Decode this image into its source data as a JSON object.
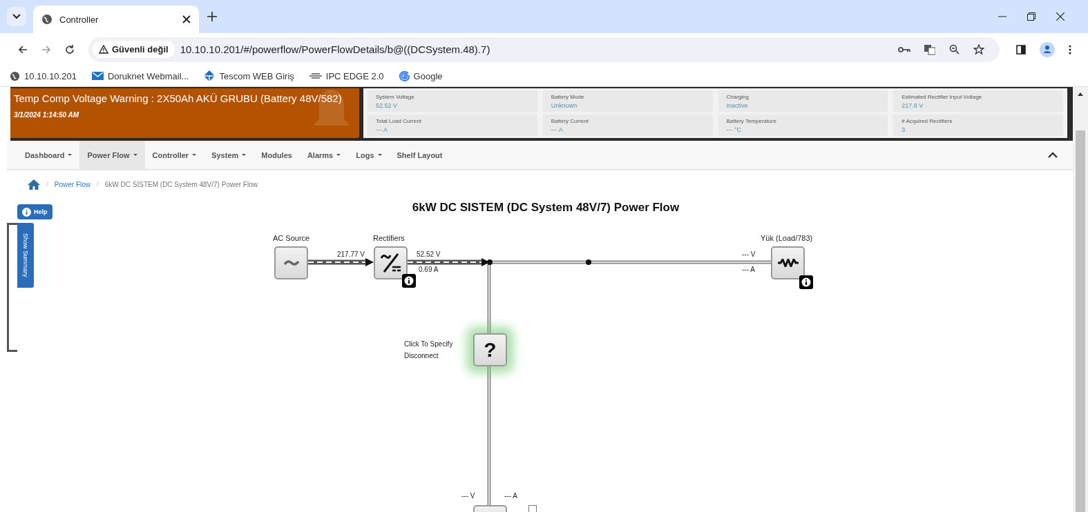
{
  "browser": {
    "tab": {
      "title": "Controller"
    },
    "address": {
      "security_label": "Güvenli değil",
      "url": "10.10.10.201/#/powerflow/PowerFlowDetails/b@((DCSystem.48).7)"
    },
    "bookmarks": [
      {
        "label": "10.10.10.201",
        "kind": "globe"
      },
      {
        "label": "Doruknet Webmail...",
        "kind": "mail"
      },
      {
        "label": "Tescom WEB Giriş",
        "kind": "diamond"
      },
      {
        "label": "IPC EDGE 2.0",
        "kind": "logo"
      },
      {
        "label": "Google",
        "kind": "google"
      }
    ]
  },
  "alarm": {
    "message": "Temp Comp Voltage Warning : 2X50Ah AKÜ GRUBU (Battery 48V/582)",
    "timestamp": "3/1/2024 1:14:50 AM"
  },
  "stats": [
    {
      "label": "System Voltage",
      "value": "52.52 V"
    },
    {
      "label": "Battery Mode",
      "value": "Unknown"
    },
    {
      "label": "Charging",
      "value": "Inactive"
    },
    {
      "label": "Estimated Rectifier Input Voltage",
      "value": "217.8 V"
    },
    {
      "label": "Total Load Current",
      "value": "--- A"
    },
    {
      "label": "Battery Current",
      "value": "--- A"
    },
    {
      "label": "Battery Temperature",
      "value": "--- °C"
    },
    {
      "label": "# Acquired Rectifiers",
      "value": "3"
    }
  ],
  "nav": [
    {
      "label": "Dashboard",
      "dropdown": true,
      "selected": false
    },
    {
      "label": "Power Flow",
      "dropdown": true,
      "selected": true
    },
    {
      "label": "Controller",
      "dropdown": true,
      "selected": false
    },
    {
      "label": "System",
      "dropdown": true,
      "selected": false
    },
    {
      "label": "Modules",
      "dropdown": false,
      "selected": false
    },
    {
      "label": "Alarms",
      "dropdown": true,
      "selected": false
    },
    {
      "label": "Logs",
      "dropdown": true,
      "selected": false
    },
    {
      "label": "Shelf Layout",
      "dropdown": false,
      "selected": false
    }
  ],
  "breadcrumb": [
    {
      "separator": "/",
      "label": "Power Flow",
      "kind": "link"
    },
    {
      "separator": "/",
      "label": "6kW DC SİSTEM (DC System 48V/7) Power Flow",
      "kind": "current"
    }
  ],
  "help_button": "Help",
  "summary_tab": "Show Summary",
  "diagram": {
    "title": "6kW DC SISTEM (DC System 48V/7) Power Flow",
    "ac_source": {
      "label": "AC Source"
    },
    "rectifiers": {
      "label": "Rectifiers",
      "input_voltage": "217.77 V",
      "output_voltage": "52.52 V",
      "output_current": "0.69 A"
    },
    "load": {
      "label": "Yük (Load/783)",
      "voltage": "--- V",
      "current": "--- A"
    },
    "disconnect": {
      "label": "Click To Specify Disconnect",
      "symbol": "?"
    },
    "battery_branch": {
      "voltage": "--- V",
      "current": "--- A"
    }
  }
}
